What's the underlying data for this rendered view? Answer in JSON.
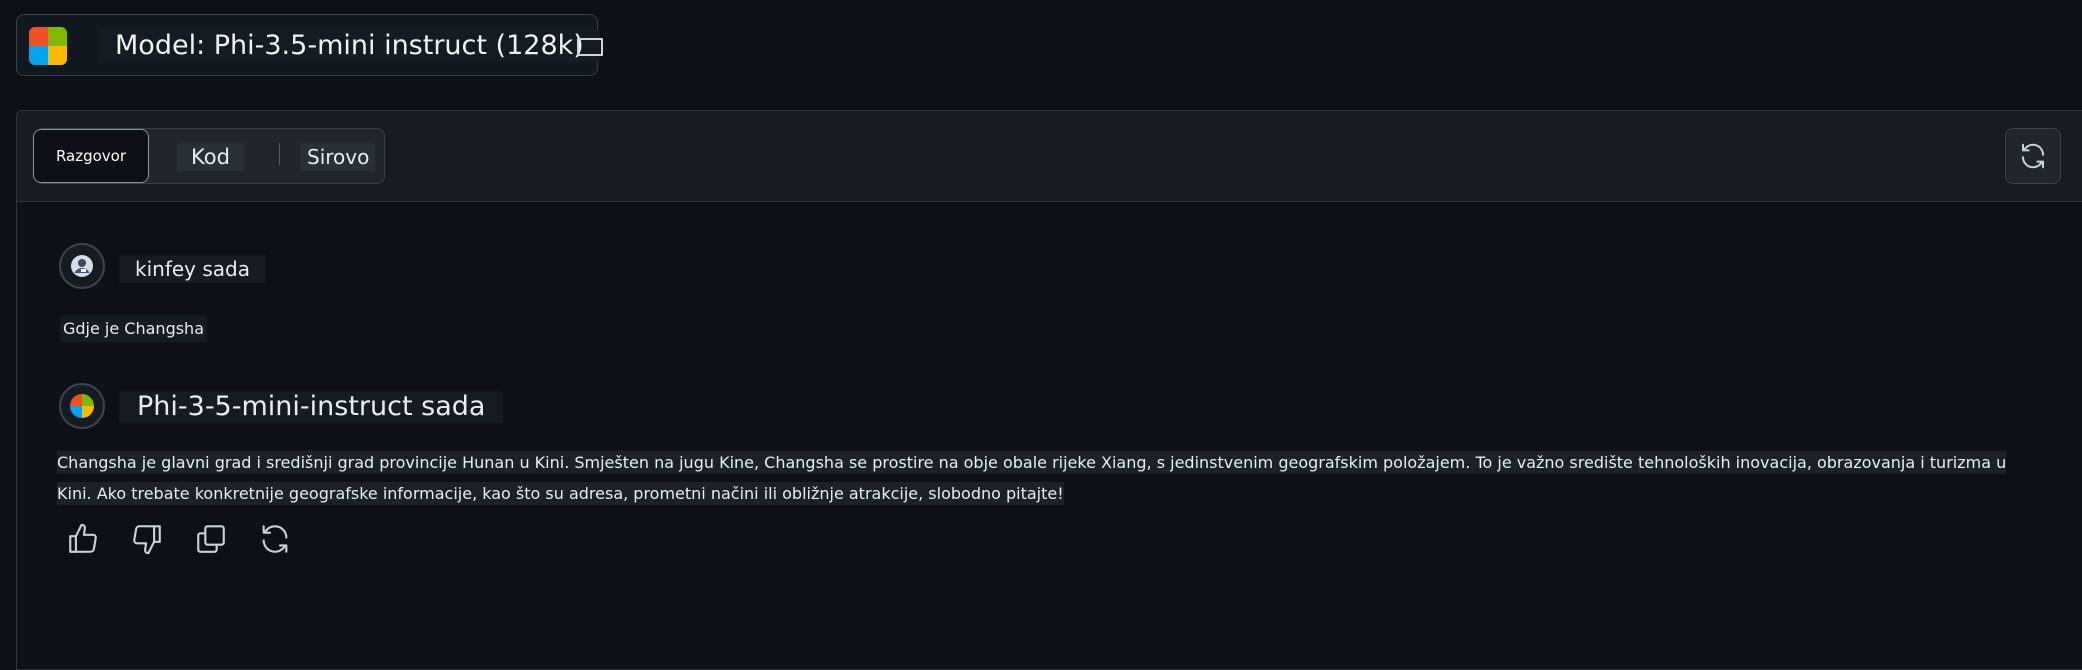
{
  "model": {
    "title": "Model: Phi-3.5-mini instruct (128k)",
    "logo_colors": [
      "#f25022",
      "#7fba00",
      "#00a4ef",
      "#ffb900"
    ]
  },
  "tabs": [
    {
      "label": "Razgovor",
      "active": true
    },
    {
      "label": "Kod",
      "active": false
    },
    {
      "label": "Sirovo",
      "active": false
    }
  ],
  "messages": [
    {
      "author": "kinfey sada",
      "text": "Gdje je Changsha"
    },
    {
      "author": "Phi-3-5-mini-instruct sada",
      "text": "Changsha je glavni grad i središnji grad provincije Hunan u Kini. Smješten na jugu Kine, Changsha se prostire na obje obale rijeke Xiang, s jedinstvenim geografskim položajem. To je važno središte tehnoloških inovacija, obrazovanja i turizma u Kini. Ako trebate konkretnije geografske informacije, kao što su adresa, prometni načini ili obližnje atrakcije, slobodno pitajte!"
    }
  ],
  "actions": [
    "thumbs-up-icon",
    "thumbs-down-icon",
    "copy-icon",
    "regenerate-icon"
  ],
  "colors": {
    "background": "#0d1117",
    "panel_header": "#161b22",
    "border": "#30363d",
    "text": "#e6edf3"
  }
}
